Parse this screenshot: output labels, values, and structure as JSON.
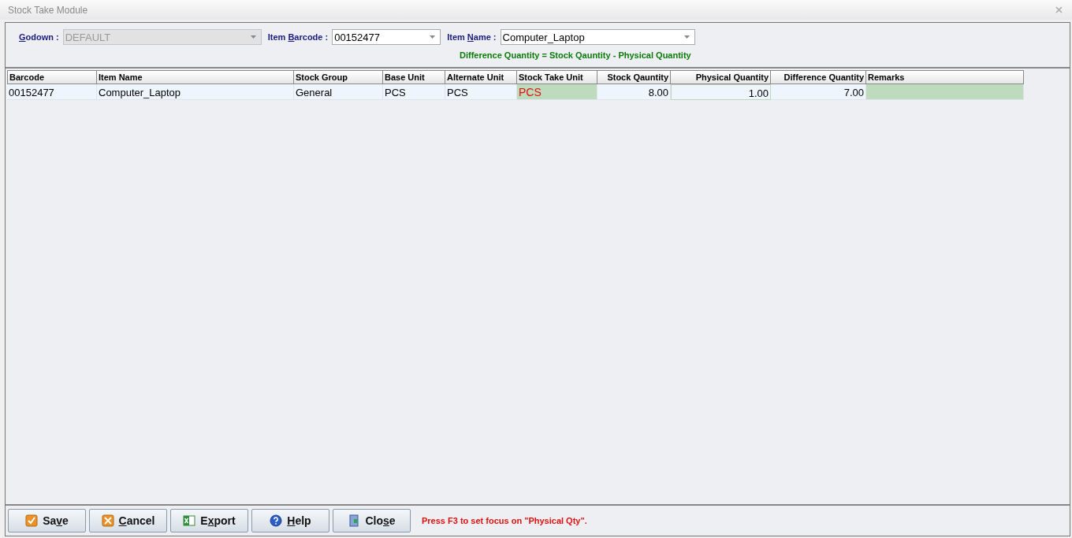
{
  "window": {
    "title": "Stock Take Module"
  },
  "filters": [
    {
      "kind": "disabled",
      "label": {
        "key": "G",
        "post": "odown :"
      },
      "value": "DEFAULT"
    },
    {
      "kind": "combo",
      "label": {
        "pre": "Item ",
        "key": "B",
        "post": "arcode :"
      },
      "value": "00152477"
    },
    {
      "kind": "combo",
      "label": {
        "pre": "Item ",
        "key": "N",
        "post": "ame :"
      },
      "value": "Computer_Laptop"
    }
  ],
  "formula": "Difference Quantity = Stock Qauntity - Physical Quantity",
  "table": {
    "columns": [
      {
        "label": "Barcode",
        "kind": "text"
      },
      {
        "label": "Item Name",
        "kind": "text"
      },
      {
        "label": "Stock Group",
        "kind": "text"
      },
      {
        "label": "Base Unit",
        "kind": "text"
      },
      {
        "label": "Alternate Unit",
        "kind": "text"
      },
      {
        "label": "Stock Take Unit",
        "kind": "unit"
      },
      {
        "label": "Stock Qauntity",
        "kind": "number"
      },
      {
        "label": "Physical Quantity",
        "kind": "input"
      },
      {
        "label": "Difference Quantity",
        "kind": "number"
      },
      {
        "label": "Remarks",
        "kind": "remark"
      }
    ],
    "rows": [
      [
        "00152477",
        "Computer_Laptop",
        "General",
        "PCS",
        "PCS",
        "PCS",
        "8.00",
        "1.00",
        "7.00",
        ""
      ]
    ]
  },
  "buttons": [
    {
      "kind": "save",
      "label": {
        "pre": "Sa",
        "key": "v",
        "post": "e"
      }
    },
    {
      "kind": "cancel",
      "label": {
        "key": "C",
        "post": "ancel"
      }
    },
    {
      "kind": "export",
      "label": {
        "pre": "E",
        "key": "x",
        "post": "port"
      }
    },
    {
      "kind": "help",
      "label": {
        "key": "H",
        "post": "elp"
      }
    },
    {
      "kind": "close",
      "label": {
        "pre": "Clo",
        "key": "s",
        "post": "e"
      }
    }
  ],
  "hint": "Press F3 to set focus on \"Physical Qty\"."
}
